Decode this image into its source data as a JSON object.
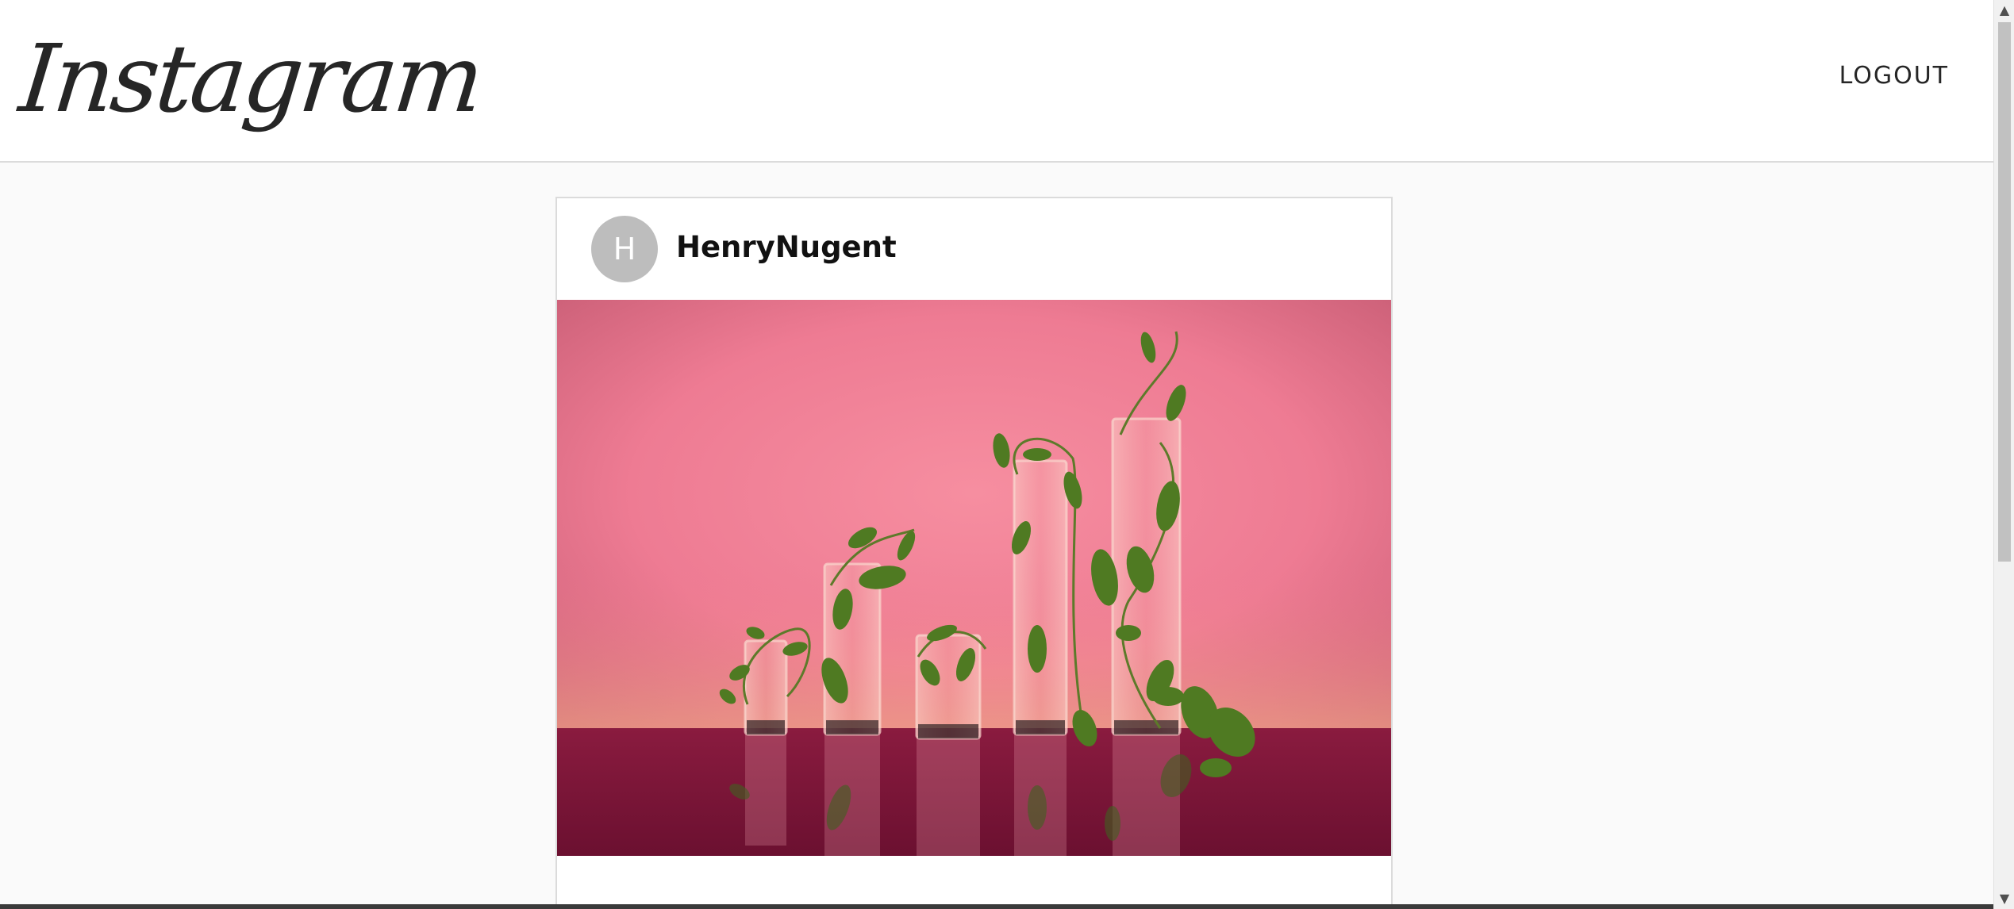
{
  "header": {
    "logo_text": "Instagram",
    "logout_label": "LOGOUT"
  },
  "post": {
    "avatar_initial": "H",
    "username": "HenryNugent",
    "image_alt": "Glass cylinders with plant vines on pink background"
  },
  "colors": {
    "background": "#fafafa",
    "card": "#ffffff",
    "border": "#dbdbdb",
    "avatar": "#bdbdbd",
    "photo_backdrop": "#ef7f95",
    "photo_table": "#7e1838"
  },
  "icons": {
    "scroll_up": "scroll-up-icon",
    "scroll_down": "scroll-down-icon"
  }
}
